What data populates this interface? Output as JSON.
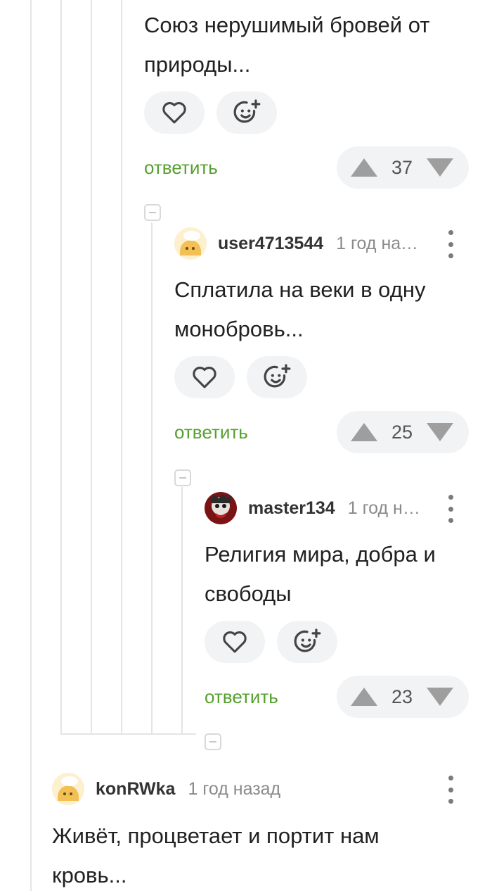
{
  "comments": [
    {
      "text": "Союз нерушимый бровей от природы...",
      "reply_label": "ответить",
      "rating": "37"
    },
    {
      "username": "user4713544",
      "time": "1 год назад",
      "text": "Сплатила на веки в одну монобровь...",
      "reply_label": "ответить",
      "rating": "25"
    },
    {
      "username": "master134",
      "time": "1 год назад",
      "text": "Религия мира, добра и свободы",
      "reply_label": "ответить",
      "rating": "23"
    },
    {
      "username": "konRWka",
      "time": "1 год назад",
      "text": "Живёт, процветает и портит нам кровь..."
    }
  ],
  "icons": {
    "like": "heart-icon",
    "reaction": "add-emoji-icon",
    "upvote": "triangle-up-icon",
    "downvote": "triangle-down-icon",
    "collapse": "minus-square-icon",
    "menu": "vertical-dots-icon"
  },
  "colors": {
    "reply": "#56a02e",
    "pill_bg": "#f2f3f5",
    "thread_line": "#e4e4e4"
  }
}
